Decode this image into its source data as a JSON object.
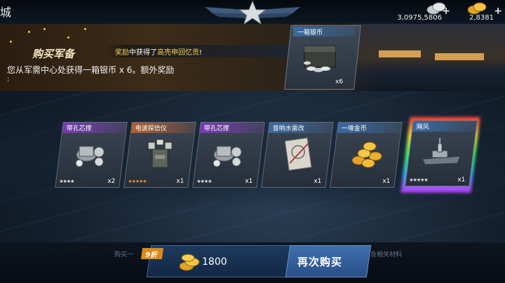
{
  "header": {
    "page_title_char": "城",
    "currency": {
      "silver": {
        "icon": "silver-coin-icon",
        "value": "3,0975,5806",
        "add": "+"
      },
      "gold": {
        "icon": "gold-coin-icon",
        "value": "2,8381",
        "add": "+"
      }
    }
  },
  "banner": {
    "title": "购买军备",
    "reward_prefix": "奖励",
    "reward_mid": "中获得了",
    "reward_item": "高壳申回忆贡",
    "reward_suffix": "!",
    "obtain_text": "您从军需中心处获得一箱银币 x 6。额外奖励",
    "bullet": ":",
    "featured_item": {
      "name": "一箱银币",
      "count": "x6",
      "icon": "silver-coin-chest-icon"
    }
  },
  "items": [
    {
      "name": "带孔芯撑",
      "count": "x2",
      "stars": "★★★★",
      "rarity": "purple",
      "icon": "part-icon"
    },
    {
      "name": "电波探信仪",
      "count": "x1",
      "stars": "★★★★★",
      "rarity": "orange",
      "icon": "radar-icon"
    },
    {
      "name": "带孔芯撑",
      "count": "x1",
      "stars": "★★★★",
      "rarity": "purple",
      "icon": "part-icon"
    },
    {
      "name": "音响水雷改",
      "count": "x1",
      "stars": "",
      "rarity": "blue",
      "icon": "blueprint-icon"
    },
    {
      "name": "一堆金币",
      "count": "x1",
      "stars": "",
      "rarity": "blue",
      "icon": "gold-coins-icon"
    },
    {
      "name": "飓风",
      "count": "x1",
      "stars": "★★★★★",
      "rarity": "rainbow",
      "icon": "warship-icon"
    }
  ],
  "footer": {
    "hint_left": "购买一",
    "hint_right": "及相关材料",
    "discount": "9折",
    "price": "1800",
    "price_icon": "gold-coin-icon",
    "buy_again": "再次购买"
  },
  "colors": {
    "accent_blue": "#3f6fae",
    "gold_text": "#f5d45a",
    "discount_orange": "#d88a1a"
  }
}
